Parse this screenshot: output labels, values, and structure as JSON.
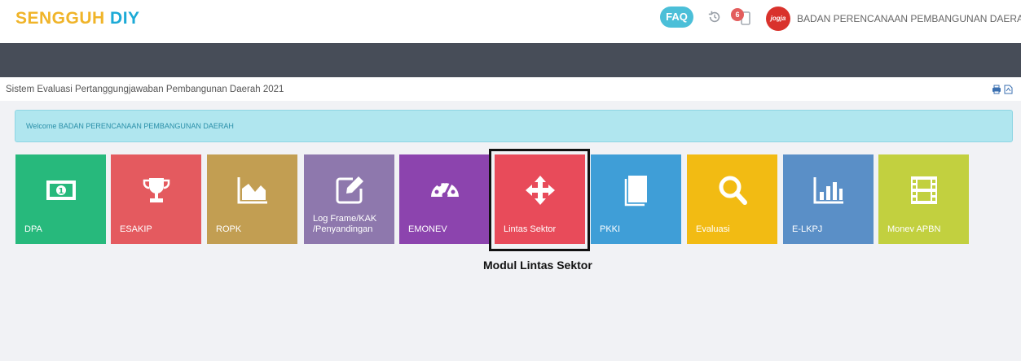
{
  "header": {
    "brand_primary": "SENGGUH",
    "brand_secondary": "DIY",
    "faq_label": "FAQ",
    "notification_count": "6",
    "avatar_text": "jogja",
    "org_name": "BADAN PERENCANAAN PEMBANGUNAN DAERAH"
  },
  "subheader": {
    "title": "Sistem Evaluasi Pertanggungjawaban Pembangunan Daerah 2021"
  },
  "welcome": {
    "message": "Welcome BADAN PERENCANAAN PEMBANGUNAN DAERAH"
  },
  "tiles": [
    {
      "label": "DPA",
      "color": "#27b97c",
      "icon": "money-icon"
    },
    {
      "label": "ESAKIP",
      "color": "#e45a5f",
      "icon": "trophy-icon"
    },
    {
      "label": "ROPK",
      "color": "#c29e52",
      "icon": "area-chart-icon"
    },
    {
      "label": "Log Frame/KAK\n/Penyandingan",
      "color": "#8e78ad",
      "icon": "edit-icon"
    },
    {
      "label": "EMONEV",
      "color": "#8c44ae",
      "icon": "dashboard-icon"
    },
    {
      "label": "Lintas Sektor",
      "color": "#e84b5a",
      "icon": "arrows-move-icon"
    },
    {
      "label": "PKKI",
      "color": "#3f9ed7",
      "icon": "book-icon"
    },
    {
      "label": "Evaluasi",
      "color": "#f2bb13",
      "icon": "search-icon"
    },
    {
      "label": "E-LKPJ",
      "color": "#5a8fc7",
      "icon": "bar-chart-icon"
    },
    {
      "label": "Monev APBN",
      "color": "#c2d03f",
      "icon": "film-icon"
    }
  ],
  "annotation": {
    "caption": "Modul Lintas Sektor"
  }
}
